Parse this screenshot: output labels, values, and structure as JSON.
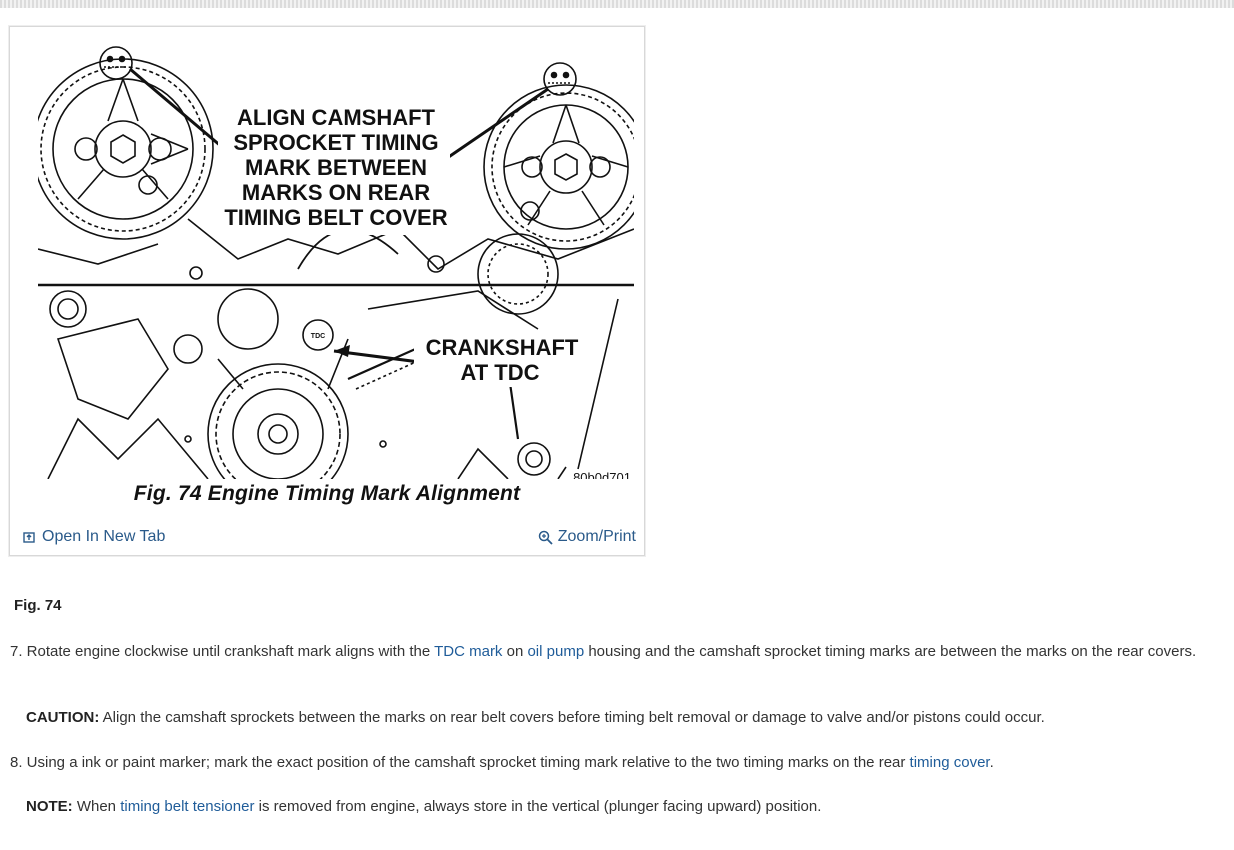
{
  "figure": {
    "caption": "Fig. 74 Engine Timing Mark Alignment",
    "diagram_labels": {
      "camshaft_callout": [
        "ALIGN CAMSHAFT",
        "SPROCKET TIMING",
        "MARK BETWEEN",
        "MARKS ON REAR",
        "TIMING BELT COVER"
      ],
      "crankshaft_callout": [
        "CRANKSHAFT",
        "AT TDC"
      ],
      "tdc_mark": "TDC",
      "image_code": "80b0d701"
    },
    "open_new_tab_label": "Open In New Tab",
    "zoom_print_label": "Zoom/Print"
  },
  "fig_label": "Fig. 74",
  "step7": {
    "prefix": "7. Rotate engine clockwise until crankshaft mark aligns with the ",
    "link1": "TDC mark",
    "mid1": " on ",
    "link2": "oil pump",
    "suffix": " housing and the camshaft sprocket timing marks are between the marks on the rear covers."
  },
  "caution": {
    "label": "CAUTION:",
    "text": " Align the camshaft sprockets between the marks on rear belt covers before timing belt removal or damage to valve and/or pistons could occur."
  },
  "step8": {
    "prefix": "8. Using a ink or paint marker; mark the exact position of the camshaft sprocket timing mark relative to the two timing marks on the rear ",
    "link": "timing cover",
    "suffix": "."
  },
  "note": {
    "label": "NOTE:",
    "pre": " When ",
    "link": "timing belt tensioner",
    "post": " is removed from engine, always store in the vertical (plunger facing upward) position."
  }
}
